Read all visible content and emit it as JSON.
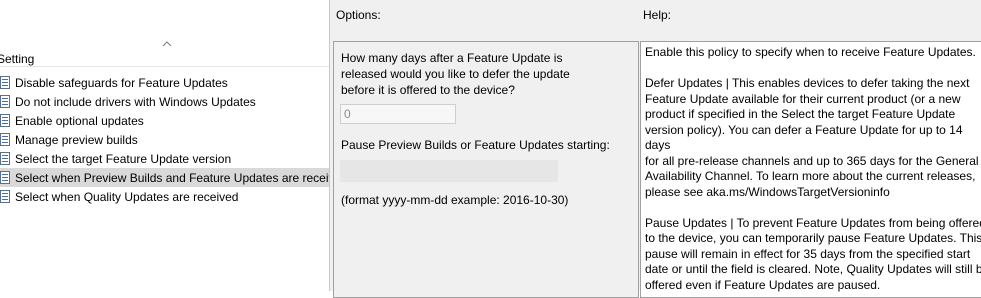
{
  "settings_pane": {
    "column_header": "Setting",
    "items": [
      {
        "label": "Disable safeguards for Feature Updates",
        "selected": false
      },
      {
        "label": "Do not include drivers with Windows Updates",
        "selected": false
      },
      {
        "label": "Enable optional updates",
        "selected": false
      },
      {
        "label": "Manage preview builds",
        "selected": false
      },
      {
        "label": "Select the target Feature Update version",
        "selected": false
      },
      {
        "label": "Select when Preview Builds and Feature Updates are received",
        "selected": true
      },
      {
        "label": "Select when Quality Updates are received",
        "selected": false
      }
    ]
  },
  "options": {
    "title": "Options:",
    "defer_question": "How many days after a Feature Update is released would you like to defer the update before it is offered to the device?",
    "defer_days_value": "0",
    "pause_label": "Pause Preview Builds or Feature Updates starting:",
    "pause_date_value": "",
    "format_hint": "(format yyyy-mm-dd example: 2016-10-30)"
  },
  "help": {
    "title": "Help:",
    "paragraphs": [
      "Enable this policy to specify when to receive Feature Updates.",
      "Defer Updates | This enables devices to defer taking the next\nFeature Update available for their current product (or a new\nproduct if specified in the Select the target Feature Update\nversion policy). You can defer a Feature Update for up to 14 days\nfor all pre-release channels and up to 365 days for the General\nAvailability Channel. To learn more about the current releases,\nplease see aka.ms/WindowsTargetVersioninfo",
      "Pause Updates | To prevent Feature Updates from being offered\nto the device, you can temporarily pause Feature Updates. This\npause will remain in effect for 35 days from the specified start\ndate or until the field is cleared. Note, Quality Updates will still be\noffered even if Feature Updates are paused."
    ]
  },
  "icons": {
    "setting_item_icon": "policy-setting-icon",
    "sort_indicator": "sort-ascending-icon"
  }
}
